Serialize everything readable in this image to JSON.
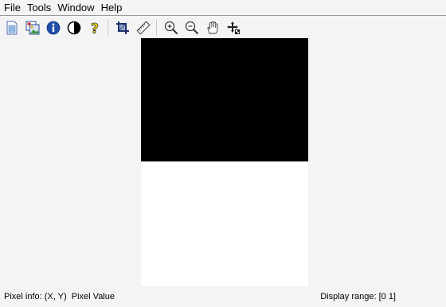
{
  "menu": {
    "items": [
      {
        "label": "File"
      },
      {
        "label": "Tools"
      },
      {
        "label": "Window"
      },
      {
        "label": "Help"
      }
    ]
  },
  "toolbar": {
    "buttons": [
      {
        "icon": "new-figure-icon"
      },
      {
        "icon": "image-overview-icon"
      },
      {
        "icon": "image-information-icon"
      },
      {
        "icon": "adjust-contrast-icon"
      },
      {
        "icon": "help-question-icon"
      },
      {
        "icon": "crop-icon"
      },
      {
        "icon": "measure-distance-icon"
      },
      {
        "icon": "zoom-in-icon"
      },
      {
        "icon": "zoom-out-icon"
      },
      {
        "icon": "pan-hand-icon"
      },
      {
        "icon": "pixel-region-icon"
      }
    ]
  },
  "image": {
    "top_color": "#000000",
    "bottom_color": "#ffffff"
  },
  "status": {
    "pixel_info": "Pixel info: (X, Y)  Pixel Value",
    "display_range": "Display range: [0 1]"
  }
}
